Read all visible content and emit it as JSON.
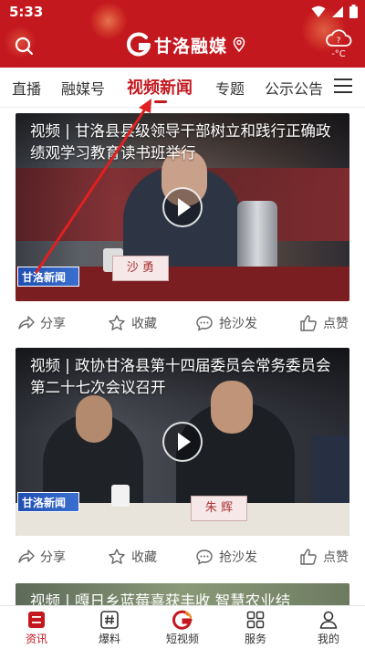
{
  "status": {
    "time": "5:33"
  },
  "header": {
    "logo_text": "甘洛融媒",
    "weather_temp": "-°C"
  },
  "tabs": [
    {
      "label": "直播",
      "active": false
    },
    {
      "label": "融媒号",
      "active": false
    },
    {
      "label": "视频新闻",
      "active": true
    },
    {
      "label": "专题",
      "active": false
    },
    {
      "label": "公示公告",
      "active": false
    }
  ],
  "feed": [
    {
      "title": "视频 | 甘洛县县级领导干部树立和践行正确政绩观学习教育读书班举行",
      "watermark": "甘洛新闻",
      "nameplate": "沙  勇"
    },
    {
      "title": "视频 | 政协甘洛县第十四届委员会常务委员会第二十七次会议召开",
      "watermark": "甘洛新闻",
      "nameplate": "朱  辉"
    },
    {
      "title": "视频 | 嘎日乡蓝莓喜获丰收 智慧农业结"
    }
  ],
  "actions": {
    "share": "分享",
    "favorite": "收藏",
    "comment": "抢沙发",
    "like": "点赞"
  },
  "bottom_nav": [
    {
      "label": "资讯",
      "icon": "news-icon",
      "active": true
    },
    {
      "label": "爆料",
      "icon": "hashtag-icon",
      "active": false
    },
    {
      "label": "短视频",
      "icon": "short-video-icon",
      "active": false
    },
    {
      "label": "服务",
      "icon": "grid-icon",
      "active": false
    },
    {
      "label": "我的",
      "icon": "user-icon",
      "active": false
    }
  ],
  "colors": {
    "brand_red": "#c4181f",
    "annotation_arrow": "#e02020"
  }
}
